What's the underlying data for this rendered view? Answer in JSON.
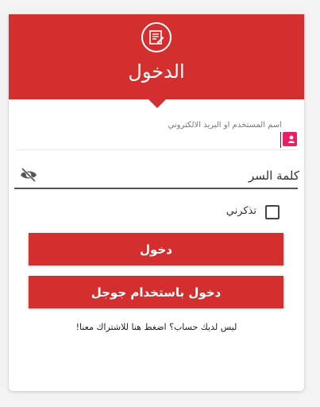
{
  "header": {
    "title": "الدخول",
    "logo_icon": "form-edit-icon"
  },
  "username": {
    "label": "اسم المستخدم او البريد الالكتروني",
    "value": "",
    "icon": "user-badge-icon"
  },
  "password": {
    "placeholder": "كلمة السر",
    "value": "",
    "icon": "eye-off-icon"
  },
  "remember": {
    "label": "تذكرني",
    "checked": false
  },
  "buttons": {
    "login": "دخول",
    "google": "دخول باستخدام جوجل"
  },
  "signup": {
    "text": "ليس لديك حساب؟ اضغط هنا للاشتراك معنا!"
  },
  "colors": {
    "accent": "#d32f2f",
    "user_icon": "#e91e63"
  }
}
